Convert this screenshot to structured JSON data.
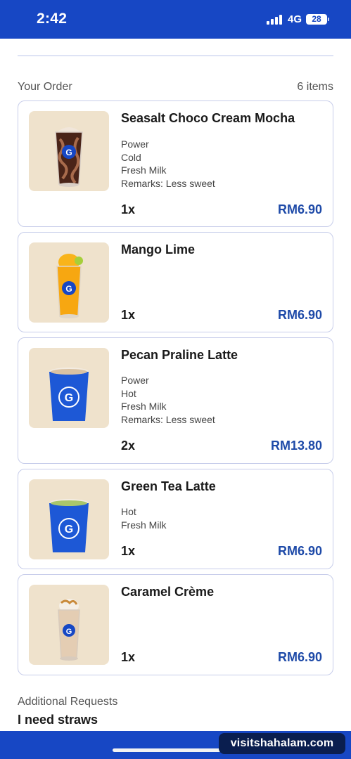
{
  "status_bar": {
    "time": "2:42",
    "network": "4G",
    "battery": "28"
  },
  "order": {
    "title": "Your Order",
    "count": "6 items"
  },
  "items": [
    {
      "name": "Seasalt Choco Cream Mocha",
      "options": [
        "Power",
        "Cold",
        "Fresh Milk",
        "Remarks: Less sweet"
      ],
      "quantity": "1x",
      "price": "RM6.90"
    },
    {
      "name": "Mango Lime",
      "options": [],
      "quantity": "1x",
      "price": "RM6.90"
    },
    {
      "name": "Pecan Praline Latte",
      "options": [
        "Power",
        "Hot",
        "Fresh Milk",
        "Remarks: Less sweet"
      ],
      "quantity": "2x",
      "price": "RM13.80"
    },
    {
      "name": "Green Tea Latte",
      "options": [
        "Hot",
        "Fresh Milk"
      ],
      "quantity": "1x",
      "price": "RM6.90"
    },
    {
      "name": "Caramel Crème",
      "options": [],
      "quantity": "1x",
      "price": "RM6.90"
    }
  ],
  "additional_requests": {
    "label": "Additional Requests",
    "value": "I need straws"
  },
  "watermark": "visitshahalam.com",
  "colors": {
    "brand_blue": "#1747c4",
    "price_blue": "#1e4aa8",
    "image_bg": "#efe2cc",
    "card_border": "#c7cdea"
  }
}
